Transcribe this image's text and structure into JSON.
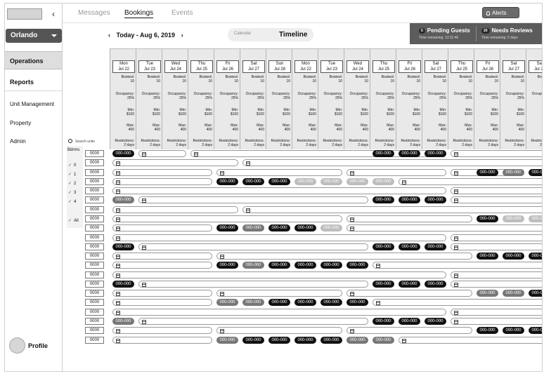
{
  "sidebar": {
    "collapse": "‹",
    "city": "Orlando",
    "nav": [
      "Operations",
      "Reports"
    ],
    "subnav": [
      "Unit Management",
      "Property",
      "Admin"
    ],
    "profile": "Profile"
  },
  "topnav": {
    "tabs": [
      "Messages",
      "Bookings",
      "Events"
    ],
    "alerts": "Alerts"
  },
  "status": {
    "pending": {
      "count": "5",
      "title": "Pending Guests",
      "sub": "Time remaining: 12:11:46"
    },
    "reviews": {
      "count": "20",
      "title": "Needs Reviews",
      "sub": "Time remaining: 5 days"
    }
  },
  "date_range": "Today - Aug 6, 2019",
  "view_toggle": {
    "calendar": "Calendar",
    "timeline": "Timeline"
  },
  "search_placeholder": "Search units",
  "bdrms": {
    "label": "Bdrms",
    "options": [
      "0",
      "1",
      "2",
      "3",
      "4",
      "All"
    ]
  },
  "stats_labels": {
    "booked": "Booked:",
    "occupancy": "Occupancy:",
    "min": "Min:",
    "max": "Max:",
    "restrictions": "Restrictions:"
  },
  "days": [
    {
      "dow": "Mon",
      "date": "Jul 22"
    },
    {
      "dow": "Tue",
      "date": "Jul 23"
    },
    {
      "dow": "Wed",
      "date": "Jul 24"
    },
    {
      "dow": "Thu",
      "date": "Jul 25"
    },
    {
      "dow": "Fri",
      "date": "Jul 26"
    },
    {
      "dow": "Sat",
      "date": "Jul 27"
    },
    {
      "dow": "Sun",
      "date": "Jul 28"
    },
    {
      "dow": "Mon",
      "date": "Jul 22"
    },
    {
      "dow": "Tue",
      "date": "Jul 23"
    },
    {
      "dow": "Wed",
      "date": "Jul 24"
    },
    {
      "dow": "Thu",
      "date": "Jul 25"
    },
    {
      "dow": "Fri",
      "date": "Jul 26"
    },
    {
      "dow": "Sat",
      "date": "Jul 27"
    },
    {
      "dow": "Thu",
      "date": "Jul 25"
    },
    {
      "dow": "Fri",
      "date": "Jul 26"
    },
    {
      "dow": "Sat",
      "date": "Jul 27"
    },
    {
      "dow": "Sat",
      "date": "Jul 27"
    }
  ],
  "day_stats": {
    "booked": "10",
    "occupancy": "25%",
    "min": "$100",
    "max": "400",
    "restrictions": "2 days"
  },
  "unit_label": "0000",
  "pill_label": "000-000",
  "rows": [
    [
      [
        "p",
        0,
        "d"
      ],
      [
        "b",
        1,
        3
      ],
      [
        "b",
        3,
        13
      ],
      [
        "p",
        10,
        "d"
      ],
      [
        "p",
        11,
        "d"
      ],
      [
        "p",
        12,
        "d"
      ],
      [
        "b",
        13,
        17
      ]
    ],
    [
      [
        "b",
        0,
        5
      ],
      [
        "b",
        5,
        17
      ]
    ],
    [
      [
        "b",
        0,
        4
      ],
      [
        "b",
        4,
        9
      ],
      [
        "b",
        9,
        13
      ],
      [
        "b",
        13,
        16
      ],
      [
        "p",
        14,
        "d"
      ],
      [
        "p",
        15,
        "m"
      ],
      [
        "p",
        16,
        "d"
      ]
    ],
    [
      [
        "b",
        0,
        4
      ],
      [
        "p",
        4,
        "d"
      ],
      [
        "p",
        5,
        "d"
      ],
      [
        "p",
        6,
        "d"
      ],
      [
        "p",
        7,
        "l"
      ],
      [
        "p",
        8,
        "l"
      ],
      [
        "p",
        9,
        "l"
      ],
      [
        "p",
        10,
        "l"
      ],
      [
        "b",
        11,
        17
      ]
    ],
    [
      [
        "b",
        0,
        13
      ],
      [
        "b",
        13,
        17
      ]
    ],
    [
      [
        "p",
        0,
        "m"
      ],
      [
        "b",
        1,
        10
      ],
      [
        "p",
        10,
        "d"
      ],
      [
        "p",
        11,
        "d"
      ],
      [
        "p",
        12,
        "d"
      ],
      [
        "b",
        13,
        17
      ]
    ],
    [
      [
        "b",
        0,
        5
      ],
      [
        "b",
        5,
        17
      ]
    ],
    [
      [
        "b",
        0,
        9
      ],
      [
        "b",
        9,
        14
      ],
      [
        "p",
        14,
        "d"
      ],
      [
        "p",
        15,
        "l"
      ],
      [
        "p",
        16,
        "l"
      ]
    ],
    [
      [
        "b",
        0,
        4
      ],
      [
        "p",
        4,
        "d"
      ],
      [
        "p",
        5,
        "m"
      ],
      [
        "p",
        6,
        "d"
      ],
      [
        "p",
        7,
        "d"
      ],
      [
        "p",
        8,
        "l"
      ],
      [
        "b",
        9,
        17
      ]
    ],
    [
      [
        "b",
        0,
        13
      ],
      [
        "b",
        13,
        17
      ]
    ],
    [
      [
        "p",
        0,
        "d"
      ],
      [
        "b",
        1,
        10
      ],
      [
        "p",
        10,
        "d"
      ],
      [
        "p",
        11,
        "d"
      ],
      [
        "p",
        12,
        "d"
      ],
      [
        "b",
        13,
        17
      ]
    ],
    [
      [
        "b",
        0,
        4
      ],
      [
        "b",
        4,
        14
      ],
      [
        "p",
        14,
        "d"
      ],
      [
        "p",
        15,
        "d"
      ],
      [
        "p",
        16,
        "d"
      ]
    ],
    [
      [
        "b",
        0,
        4
      ],
      [
        "p",
        4,
        "d"
      ],
      [
        "p",
        5,
        "m"
      ],
      [
        "p",
        6,
        "d"
      ],
      [
        "p",
        7,
        "d"
      ],
      [
        "p",
        8,
        "d"
      ],
      [
        "p",
        9,
        "d"
      ],
      [
        "b",
        10,
        17
      ]
    ],
    [
      [
        "b",
        0,
        13
      ],
      [
        "b",
        13,
        17
      ]
    ],
    [
      [
        "p",
        0,
        "d"
      ],
      [
        "b",
        1,
        10
      ],
      [
        "p",
        10,
        "d"
      ],
      [
        "p",
        11,
        "d"
      ],
      [
        "p",
        12,
        "d"
      ],
      [
        "b",
        13,
        17
      ]
    ],
    [
      [
        "b",
        0,
        4
      ],
      [
        "b",
        4,
        9
      ],
      [
        "b",
        9,
        14
      ],
      [
        "p",
        14,
        "m"
      ],
      [
        "p",
        15,
        "m"
      ],
      [
        "p",
        16,
        "d"
      ]
    ],
    [
      [
        "b",
        0,
        4
      ],
      [
        "p",
        4,
        "m"
      ],
      [
        "p",
        5,
        "m"
      ],
      [
        "p",
        6,
        "d"
      ],
      [
        "p",
        7,
        "d"
      ],
      [
        "p",
        8,
        "d"
      ],
      [
        "p",
        9,
        "d"
      ],
      [
        "b",
        10,
        17
      ]
    ],
    [
      [
        "b",
        0,
        13
      ],
      [
        "b",
        13,
        17
      ]
    ],
    [
      [
        "p",
        0,
        "m"
      ],
      [
        "b",
        1,
        10
      ],
      [
        "p",
        10,
        "d"
      ],
      [
        "p",
        11,
        "d"
      ],
      [
        "p",
        12,
        "d"
      ],
      [
        "b",
        13,
        17
      ]
    ],
    [
      [
        "b",
        0,
        4
      ],
      [
        "b",
        4,
        9
      ],
      [
        "b",
        9,
        14
      ],
      [
        "p",
        14,
        "d"
      ],
      [
        "p",
        15,
        "d"
      ],
      [
        "p",
        16,
        "d"
      ]
    ],
    [
      [
        "b",
        0,
        4
      ],
      [
        "p",
        4,
        "m"
      ],
      [
        "p",
        5,
        "d"
      ],
      [
        "p",
        6,
        "d"
      ],
      [
        "p",
        7,
        "d"
      ],
      [
        "p",
        8,
        "d"
      ],
      [
        "p",
        9,
        "m"
      ],
      [
        "p",
        10,
        "m"
      ],
      [
        "b",
        11,
        17
      ]
    ]
  ]
}
